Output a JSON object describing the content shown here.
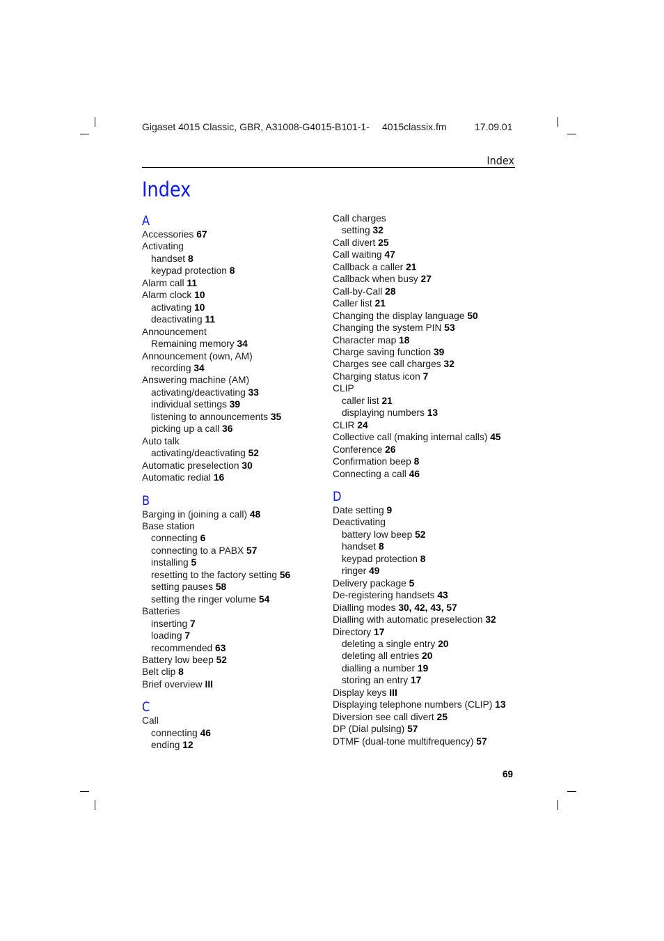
{
  "header": {
    "doc_info": "Gigaset 4015 Classic, GBR, A31008-G4015-B101-1-",
    "file_name": "4015classix.fm",
    "date": "17.09.01",
    "running_title": "Index"
  },
  "page_title": "Index",
  "page_number": "69",
  "columns": [
    [
      {
        "type": "letter",
        "text": "A"
      },
      {
        "type": "entry",
        "text": "Accessories ",
        "page": "67"
      },
      {
        "type": "entry",
        "text": "Activating",
        "page": ""
      },
      {
        "type": "sub",
        "text": "handset ",
        "page": "8"
      },
      {
        "type": "sub",
        "text": "keypad protection ",
        "page": "8"
      },
      {
        "type": "entry",
        "text": "Alarm call ",
        "page": "11"
      },
      {
        "type": "entry",
        "text": "Alarm clock ",
        "page": "10"
      },
      {
        "type": "sub",
        "text": "activating ",
        "page": "10"
      },
      {
        "type": "sub",
        "text": "deactivating ",
        "page": "11"
      },
      {
        "type": "entry",
        "text": "Announcement",
        "page": ""
      },
      {
        "type": "sub",
        "text": "Remaining memory ",
        "page": "34"
      },
      {
        "type": "entry",
        "text": "Announcement (own, AM)",
        "page": ""
      },
      {
        "type": "sub",
        "text": "recording ",
        "page": "34"
      },
      {
        "type": "entry",
        "text": "Answering machine (AM)",
        "page": ""
      },
      {
        "type": "sub",
        "text": "activating/deactivating ",
        "page": "33"
      },
      {
        "type": "sub",
        "text": "individual settings ",
        "page": "39"
      },
      {
        "type": "sub",
        "text": "listening to announcements ",
        "page": "35"
      },
      {
        "type": "sub",
        "text": "picking up a call ",
        "page": "36"
      },
      {
        "type": "entry",
        "text": "Auto talk",
        "page": ""
      },
      {
        "type": "sub",
        "text": "activating/deactivating ",
        "page": "52"
      },
      {
        "type": "entry",
        "text": "Automatic preselection ",
        "page": "30"
      },
      {
        "type": "entry",
        "text": "Automatic redial ",
        "page": "16"
      },
      {
        "type": "letter",
        "text": "B"
      },
      {
        "type": "entry",
        "text": "Barging in (joining a call) ",
        "page": "48"
      },
      {
        "type": "entry",
        "text": "Base station",
        "page": ""
      },
      {
        "type": "sub",
        "text": "connecting ",
        "page": "6"
      },
      {
        "type": "sub",
        "text": "connecting to a PABX ",
        "page": "57"
      },
      {
        "type": "sub",
        "text": "installing ",
        "page": "5"
      },
      {
        "type": "sub",
        "text": "resetting to the factory setting ",
        "page": "56"
      },
      {
        "type": "sub",
        "text": "setting pauses ",
        "page": "58"
      },
      {
        "type": "sub",
        "text": "setting the ringer volume ",
        "page": "54"
      },
      {
        "type": "entry",
        "text": "Batteries",
        "page": ""
      },
      {
        "type": "sub",
        "text": "inserting ",
        "page": "7"
      },
      {
        "type": "sub",
        "text": "loading ",
        "page": "7"
      },
      {
        "type": "sub",
        "text": "recommended ",
        "page": "63"
      },
      {
        "type": "entry",
        "text": "Battery low beep ",
        "page": "52"
      },
      {
        "type": "entry",
        "text": "Belt clip ",
        "page": "8"
      },
      {
        "type": "entry",
        "text": "Brief overview ",
        "page": "III"
      },
      {
        "type": "letter",
        "text": "C"
      },
      {
        "type": "entry",
        "text": "Call",
        "page": ""
      },
      {
        "type": "sub",
        "text": "connecting ",
        "page": "46"
      },
      {
        "type": "sub",
        "text": "ending ",
        "page": "12"
      }
    ],
    [
      {
        "type": "entry",
        "text": "Call charges",
        "page": ""
      },
      {
        "type": "sub",
        "text": "setting ",
        "page": "32"
      },
      {
        "type": "entry",
        "text": "Call divert ",
        "page": "25"
      },
      {
        "type": "entry",
        "text": "Call waiting ",
        "page": "47"
      },
      {
        "type": "entry",
        "text": "Callback a caller ",
        "page": "21"
      },
      {
        "type": "entry",
        "text": "Callback when busy ",
        "page": "27"
      },
      {
        "type": "entry",
        "text": "Call-by-Call ",
        "page": "28"
      },
      {
        "type": "entry",
        "text": "Caller list ",
        "page": "21"
      },
      {
        "type": "entry",
        "text": "Changing the display language ",
        "page": "50"
      },
      {
        "type": "entry",
        "text": "Changing the system PIN ",
        "page": "53"
      },
      {
        "type": "entry",
        "text": "Character map ",
        "page": "18"
      },
      {
        "type": "entry",
        "text": "Charge saving function ",
        "page": "39"
      },
      {
        "type": "entry",
        "text": "Charges see call charges ",
        "page": "32"
      },
      {
        "type": "entry",
        "text": "Charging status icon ",
        "page": "7"
      },
      {
        "type": "entry",
        "text": "CLIP",
        "page": ""
      },
      {
        "type": "sub",
        "text": "caller list ",
        "page": "21"
      },
      {
        "type": "sub",
        "text": "displaying numbers ",
        "page": "13"
      },
      {
        "type": "entry",
        "text": "CLIR ",
        "page": "24"
      },
      {
        "type": "entry",
        "text": "Collective call (making internal calls) ",
        "page": "45"
      },
      {
        "type": "entry",
        "text": "Conference ",
        "page": "26"
      },
      {
        "type": "entry",
        "text": "Confirmation beep ",
        "page": "8"
      },
      {
        "type": "entry",
        "text": "Connecting a call ",
        "page": "46"
      },
      {
        "type": "letter",
        "text": "D"
      },
      {
        "type": "entry",
        "text": "Date setting ",
        "page": "9"
      },
      {
        "type": "entry",
        "text": "Deactivating",
        "page": ""
      },
      {
        "type": "sub",
        "text": "battery low beep ",
        "page": "52"
      },
      {
        "type": "sub",
        "text": "handset ",
        "page": "8"
      },
      {
        "type": "sub",
        "text": "keypad protection ",
        "page": "8"
      },
      {
        "type": "sub",
        "text": "ringer ",
        "page": "49"
      },
      {
        "type": "entry",
        "text": "Delivery package ",
        "page": "5"
      },
      {
        "type": "entry",
        "text": "De-registering handsets ",
        "page": "43"
      },
      {
        "type": "entry",
        "text": "Dialling modes ",
        "page": "30, 42, 43, 57"
      },
      {
        "type": "entry",
        "text": "Dialling with automatic preselection ",
        "page": "32"
      },
      {
        "type": "entry",
        "text": "Directory ",
        "page": "17"
      },
      {
        "type": "sub",
        "text": "deleting a single entry ",
        "page": "20"
      },
      {
        "type": "sub",
        "text": "deleting all entries ",
        "page": "20"
      },
      {
        "type": "sub",
        "text": "dialling a number ",
        "page": "19"
      },
      {
        "type": "sub",
        "text": "storing an entry ",
        "page": "17"
      },
      {
        "type": "entry",
        "text": "Display keys ",
        "page": "III"
      },
      {
        "type": "entry",
        "text": "Displaying telephone numbers (CLIP) ",
        "page": "13"
      },
      {
        "type": "entry",
        "text": "Diversion see call divert ",
        "page": "25"
      },
      {
        "type": "entry",
        "text": "DP (Dial pulsing) ",
        "page": "57"
      },
      {
        "type": "entry",
        "text": "DTMF (dual-tone multifrequency) ",
        "page": "57"
      }
    ]
  ]
}
